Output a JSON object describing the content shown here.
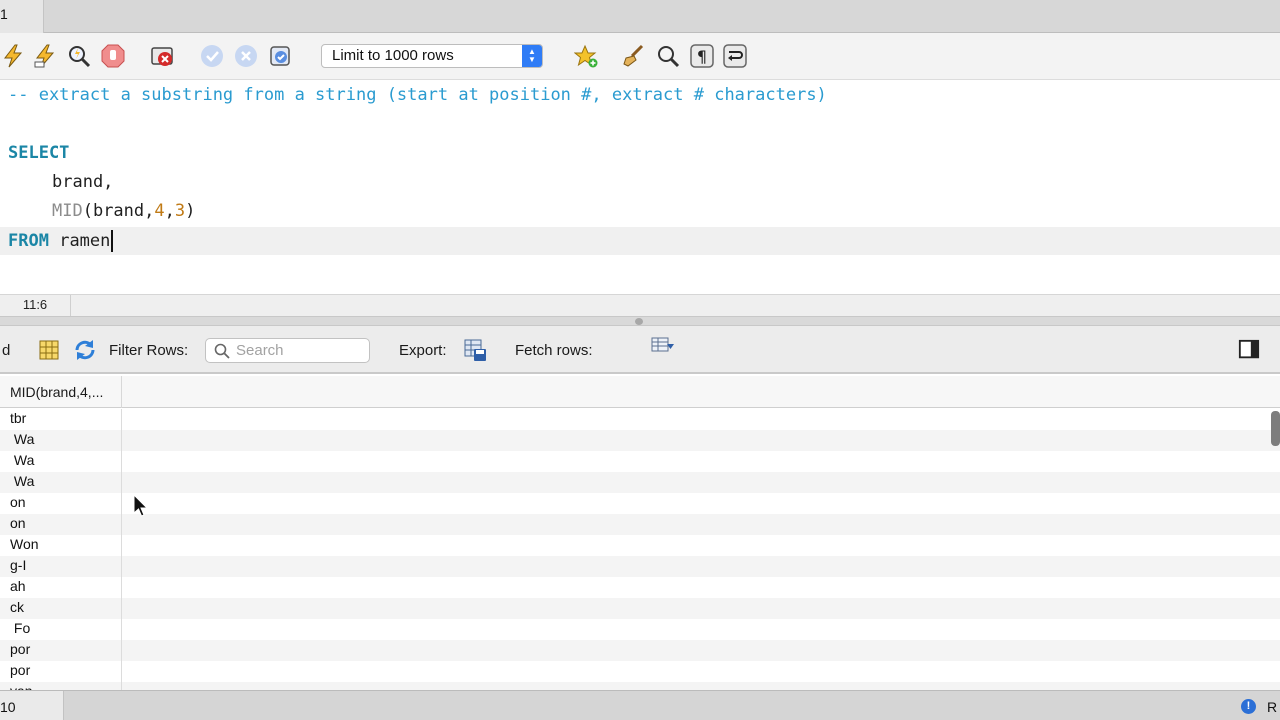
{
  "tabstrip": {
    "tab_label": "1"
  },
  "toolbar": {
    "limit_select": "Limit to 1000 rows",
    "icons": [
      "execute-icon",
      "execute-current-icon",
      "explain-icon",
      "stop-icon",
      "stop-on-error-icon",
      "commit-icon",
      "rollback-icon",
      "autocommit-icon",
      "add-snippet-icon",
      "beautify-icon",
      "find-icon",
      "invisibles-icon",
      "wrap-icon"
    ]
  },
  "editor": {
    "comment": "-- extract a substring from a string (start at position #, extract # characters)",
    "kw_select": "SELECT",
    "line_brand": "brand,",
    "mid_fn": "MID",
    "mid_open": "(brand,",
    "mid_arg1": "4",
    "mid_comma": ",",
    "mid_arg2": "3",
    "mid_close": ")",
    "kw_from": "FROM",
    "table_name": "ramen"
  },
  "editor_status": {
    "cursor_position": "11:6"
  },
  "result_toolbar": {
    "partial_label": "d",
    "filter_label": "Filter Rows:",
    "search_placeholder": "Search",
    "export_label": "Export:",
    "fetch_label": "Fetch rows:"
  },
  "grid": {
    "column_header": "MID(brand,4,...",
    "rows": [
      "tbr",
      " Wa",
      " Wa",
      " Wa",
      "on",
      "on",
      "Won",
      "g-I",
      "ah",
      "ck",
      " Fo",
      "por",
      "por",
      "yan"
    ]
  },
  "bottom_status": {
    "left_text": "10",
    "right_text": "R"
  },
  "colors": {
    "keyword": "#1b86a6",
    "comment": "#2a9bd0",
    "number": "#c07a15",
    "function": "#8c8c8c",
    "accent": "#2f7cf6"
  }
}
